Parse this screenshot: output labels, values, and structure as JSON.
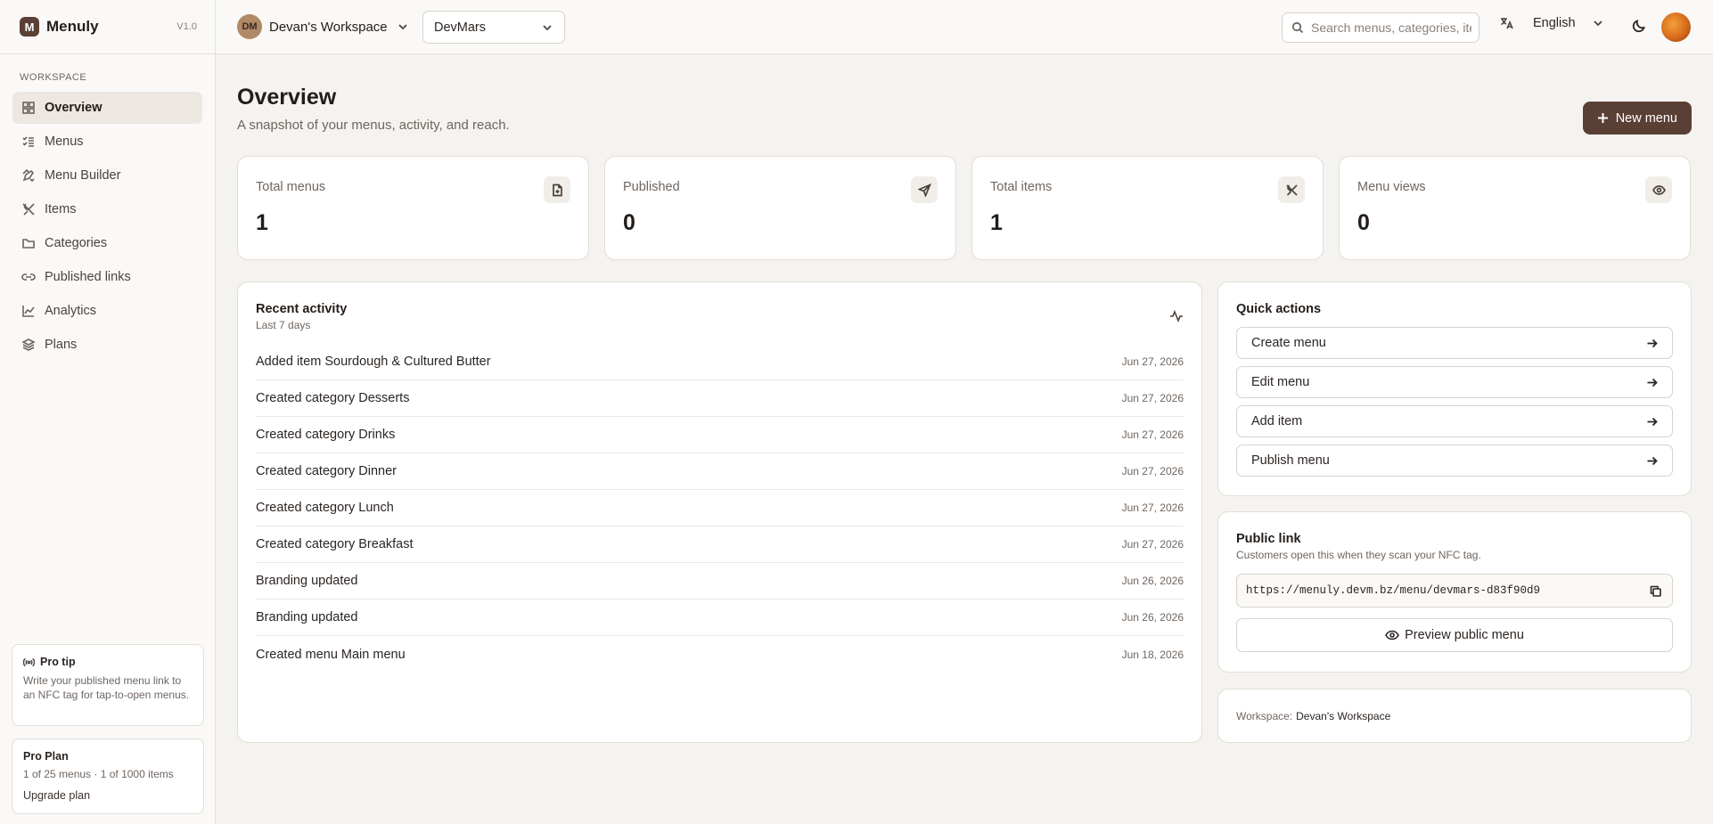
{
  "app": {
    "name": "Menuly",
    "version": "V1.0",
    "logo_letter": "M"
  },
  "sidebar": {
    "section_label": "WORKSPACE",
    "items": [
      {
        "label": "Overview",
        "icon": "grid-icon",
        "active": true
      },
      {
        "label": "Menus",
        "icon": "list-check-icon",
        "active": false
      },
      {
        "label": "Menu Builder",
        "icon": "pencil-ruler-icon",
        "active": false
      },
      {
        "label": "Items",
        "icon": "utensils-icon",
        "active": false
      },
      {
        "label": "Categories",
        "icon": "folder-icon",
        "active": false
      },
      {
        "label": "Published links",
        "icon": "link-icon",
        "active": false
      },
      {
        "label": "Analytics",
        "icon": "line-chart-icon",
        "active": false
      },
      {
        "label": "Plans",
        "icon": "layers-icon",
        "active": false
      }
    ],
    "tip": {
      "title": "Pro tip",
      "body": "Write your published menu link to an NFC tag for tap-to-open menus."
    },
    "plan": {
      "title": "Pro Plan",
      "usage": "1 of 25 menus · 1 of 1000 items",
      "upgrade_label": "Upgrade plan"
    }
  },
  "topbar": {
    "workspace": {
      "initials": "DM",
      "name": "Devan's Workspace"
    },
    "org_select": {
      "value": "DevMars"
    },
    "search": {
      "placeholder": "Search menus, categories, items"
    },
    "language": {
      "value": "English"
    }
  },
  "page": {
    "title": "Overview",
    "subtitle": "A snapshot of your menus, activity, and reach.",
    "new_button": "New menu"
  },
  "stats": [
    {
      "label": "Total menus",
      "value": "1",
      "icon": "file-plus-icon"
    },
    {
      "label": "Published",
      "value": "0",
      "icon": "send-icon"
    },
    {
      "label": "Total items",
      "value": "1",
      "icon": "utensils-crossed-icon"
    },
    {
      "label": "Menu views",
      "value": "0",
      "icon": "eye-icon"
    }
  ],
  "activity": {
    "title": "Recent activity",
    "subtitle": "Last 7 days",
    "rows": [
      {
        "text": "Added item Sourdough & Cultured Butter",
        "date": "Jun 27, 2026"
      },
      {
        "text": "Created category Desserts",
        "date": "Jun 27, 2026"
      },
      {
        "text": "Created category Drinks",
        "date": "Jun 27, 2026"
      },
      {
        "text": "Created category Dinner",
        "date": "Jun 27, 2026"
      },
      {
        "text": "Created category Lunch",
        "date": "Jun 27, 2026"
      },
      {
        "text": "Created category Breakfast",
        "date": "Jun 27, 2026"
      },
      {
        "text": "Branding updated",
        "date": "Jun 26, 2026"
      },
      {
        "text": "Branding updated",
        "date": "Jun 26, 2026"
      },
      {
        "text": "Created menu Main menu",
        "date": "Jun 18, 2026"
      }
    ]
  },
  "quick_actions": {
    "title": "Quick actions",
    "items": [
      "Create menu",
      "Edit menu",
      "Add item",
      "Publish menu"
    ]
  },
  "public_link": {
    "title": "Public link",
    "subtitle": "Customers open this when they scan your NFC tag.",
    "url": "https://menuly.devm.bz/menu/devmars-d83f90d9",
    "preview_label": "Preview public menu"
  },
  "workspace_info": {
    "label": "Workspace:",
    "value": "Devan's Workspace"
  },
  "colors": {
    "accent": "#5a4034",
    "background": "#f5f3f0",
    "active_nav": "#ece7e1"
  }
}
